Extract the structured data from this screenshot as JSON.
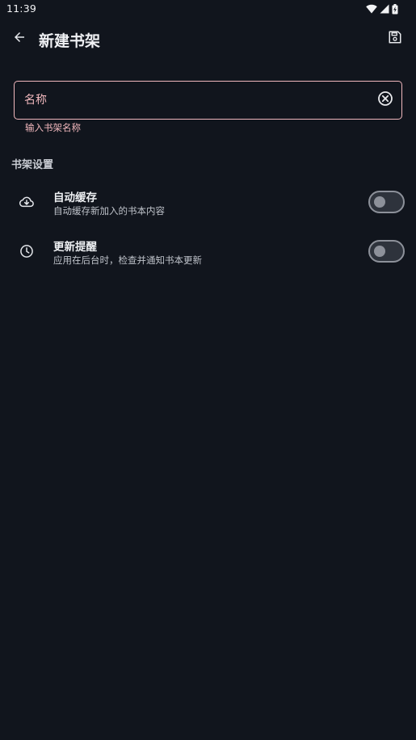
{
  "status_bar": {
    "time": "11:39",
    "icons": [
      "wifi-icon",
      "cell-signal-icon",
      "battery-charging-icon"
    ]
  },
  "app_bar": {
    "title": "新建书架",
    "back_icon": "arrow-left-icon",
    "save_icon": "save-icon"
  },
  "name_field": {
    "value": "",
    "placeholder": "名称",
    "helper": "输入书架名称",
    "clear_icon": "clear-circle-icon"
  },
  "section": {
    "title": "书架设置",
    "items": [
      {
        "icon": "cloud-download-icon",
        "title": "自动缓存",
        "subtitle": "自动缓存新加入的书本内容",
        "enabled": false
      },
      {
        "icon": "clock-icon",
        "title": "更新提醒",
        "subtitle": "应用在后台时，检查并通知书本更新",
        "enabled": false
      }
    ]
  },
  "colors": {
    "background": "#11151d",
    "error_accent": "#f1b8bd",
    "text_primary": "#eef0f3",
    "text_secondary": "#bfc3ca",
    "switch_off": "#8d919a"
  }
}
